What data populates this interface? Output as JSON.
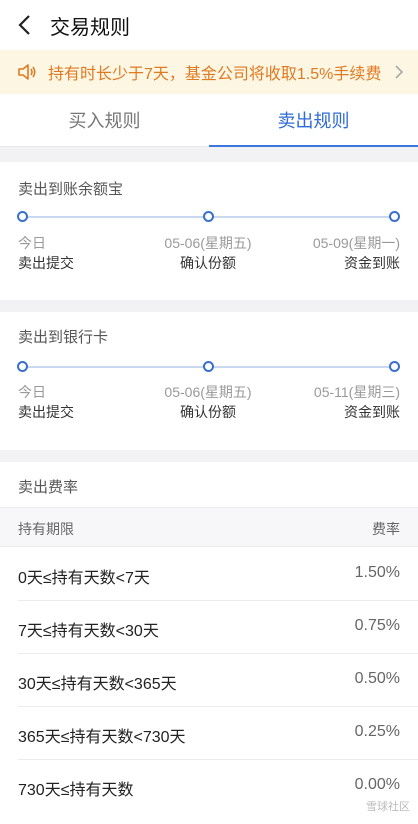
{
  "header": {
    "title": "交易规则",
    "back_icon": "chevron-left-icon"
  },
  "notice": {
    "text": "持有时长少于7天，基金公司将收取1.5%手续费",
    "icon": "speaker-icon",
    "arrow_icon": "chevron-right-icon",
    "color": "#e07a22"
  },
  "tabs": [
    {
      "label": "买入规则",
      "active": false
    },
    {
      "label": "卖出规则",
      "active": true
    }
  ],
  "to_yuebao": {
    "title": "卖出到账余额宝",
    "steps": [
      {
        "date": "今日",
        "label": "卖出提交"
      },
      {
        "date": "05-06(星期五)",
        "label": "确认份额"
      },
      {
        "date": "05-09(星期一)",
        "label": "资金到账"
      }
    ]
  },
  "to_bank": {
    "title": "卖出到银行卡",
    "steps": [
      {
        "date": "今日",
        "label": "卖出提交"
      },
      {
        "date": "05-06(星期五)",
        "label": "确认份额"
      },
      {
        "date": "05-11(星期三)",
        "label": "资金到账"
      }
    ]
  },
  "fee": {
    "title": "卖出费率",
    "headers": {
      "period": "持有期限",
      "rate": "费率"
    },
    "rows": [
      {
        "period": "0天≤持有天数<7天",
        "rate": "1.50%"
      },
      {
        "period": "7天≤持有天数<30天",
        "rate": "0.75%"
      },
      {
        "period": "30天≤持有天数<365天",
        "rate": "0.50%"
      },
      {
        "period": "365天≤持有天数<730天",
        "rate": "0.25%"
      },
      {
        "period": "730天≤持有天数",
        "rate": "0.00%"
      }
    ]
  },
  "watermark": "雪球社区"
}
